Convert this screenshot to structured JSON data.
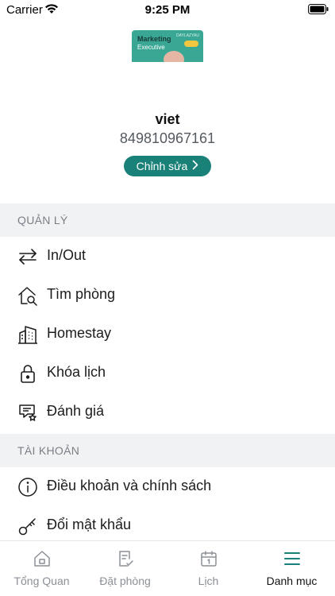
{
  "status_bar": {
    "carrier": "Carrier",
    "time": "9:25 PM"
  },
  "profile": {
    "avatar_text_line1": "Marketing",
    "avatar_text_line2": "Executive",
    "avatar_brand": "DAYLAZYAU",
    "name": "viet",
    "phone": "849810967161",
    "edit_label": "Chỉnh sửa"
  },
  "sections": {
    "manage": {
      "title": "QUẢN LÝ",
      "items": [
        {
          "label": "In/Out",
          "icon": "swap-arrows-icon"
        },
        {
          "label": "Tìm phòng",
          "icon": "house-search-icon"
        },
        {
          "label": "Homestay",
          "icon": "building-icon"
        },
        {
          "label": "Khóa lịch",
          "icon": "lock-icon"
        },
        {
          "label": "Đánh giá",
          "icon": "review-star-icon"
        }
      ]
    },
    "account": {
      "title": "TÀI KHOẢN",
      "items": [
        {
          "label": "Điều khoản và chính sách",
          "icon": "info-circle-icon"
        },
        {
          "label": "Đổi mật khẩu",
          "icon": "key-icon"
        }
      ]
    }
  },
  "tabbar": {
    "tabs": [
      {
        "label": "Tổng Quan",
        "icon": "home-icon",
        "active": false
      },
      {
        "label": "Đặt phòng",
        "icon": "booking-icon",
        "active": false
      },
      {
        "label": "Lịch",
        "icon": "calendar-icon",
        "active": false
      },
      {
        "label": "Danh mục",
        "icon": "menu-icon",
        "active": true
      }
    ]
  },
  "colors": {
    "accent": "#1a8179",
    "section_bg": "#f1f2f4",
    "inactive_tab": "#8b9096"
  }
}
